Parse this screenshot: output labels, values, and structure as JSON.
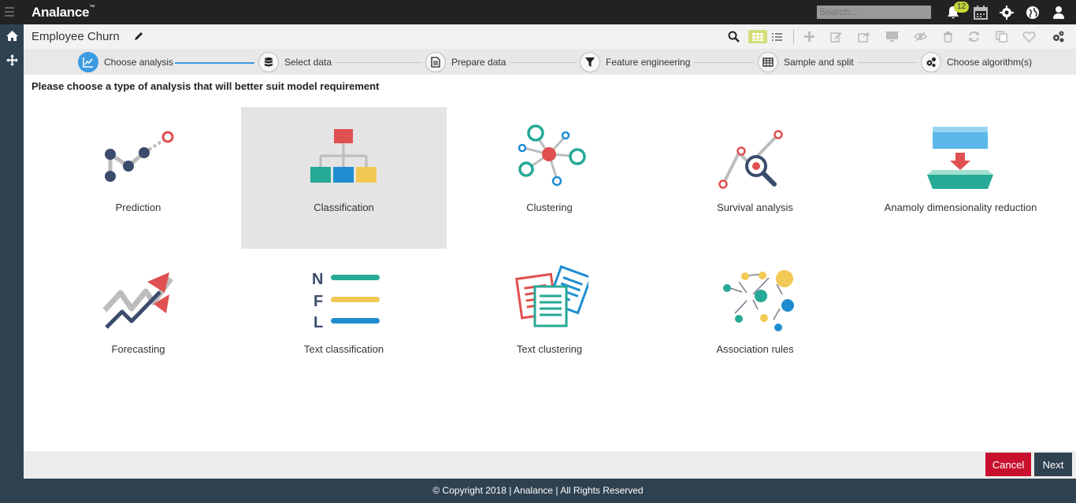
{
  "app": {
    "logo": "Analance",
    "logo_tm": "™"
  },
  "topbar": {
    "search_placeholder": "Search...",
    "notification_count": "12"
  },
  "page": {
    "title": "Employee Churn",
    "prompt": "Please choose a type of analysis that will better suit model requirement"
  },
  "steps": [
    {
      "label": "Choose analysis"
    },
    {
      "label": "Select data"
    },
    {
      "label": "Prepare data"
    },
    {
      "label": "Feature engineering"
    },
    {
      "label": "Sample and split"
    },
    {
      "label": "Choose algorithm(s)"
    }
  ],
  "analysis_types": [
    {
      "label": "Prediction",
      "icon": "prediction-icon"
    },
    {
      "label": "Classification",
      "icon": "classification-icon"
    },
    {
      "label": "Clustering",
      "icon": "clustering-icon"
    },
    {
      "label": "Survival analysis",
      "icon": "survival-analysis-icon"
    },
    {
      "label": "Anamoly dimensionality reduction",
      "icon": "dimensionality-reduction-icon"
    },
    {
      "label": "Forecasting",
      "icon": "forecasting-icon"
    },
    {
      "label": "Text classification",
      "icon": "text-classification-icon"
    },
    {
      "label": "Text clustering",
      "icon": "text-clustering-icon"
    },
    {
      "label": "Association rules",
      "icon": "association-rules-icon"
    }
  ],
  "buttons": {
    "cancel": "Cancel",
    "next": "Next"
  },
  "footer": {
    "copyright": "© Copyright 2018 | Analance | All Rights Reserved"
  },
  "colors": {
    "accent": "#3c9be0",
    "cancel": "#c8102e",
    "dark": "#2e4150",
    "badge": "#c6d63a"
  }
}
